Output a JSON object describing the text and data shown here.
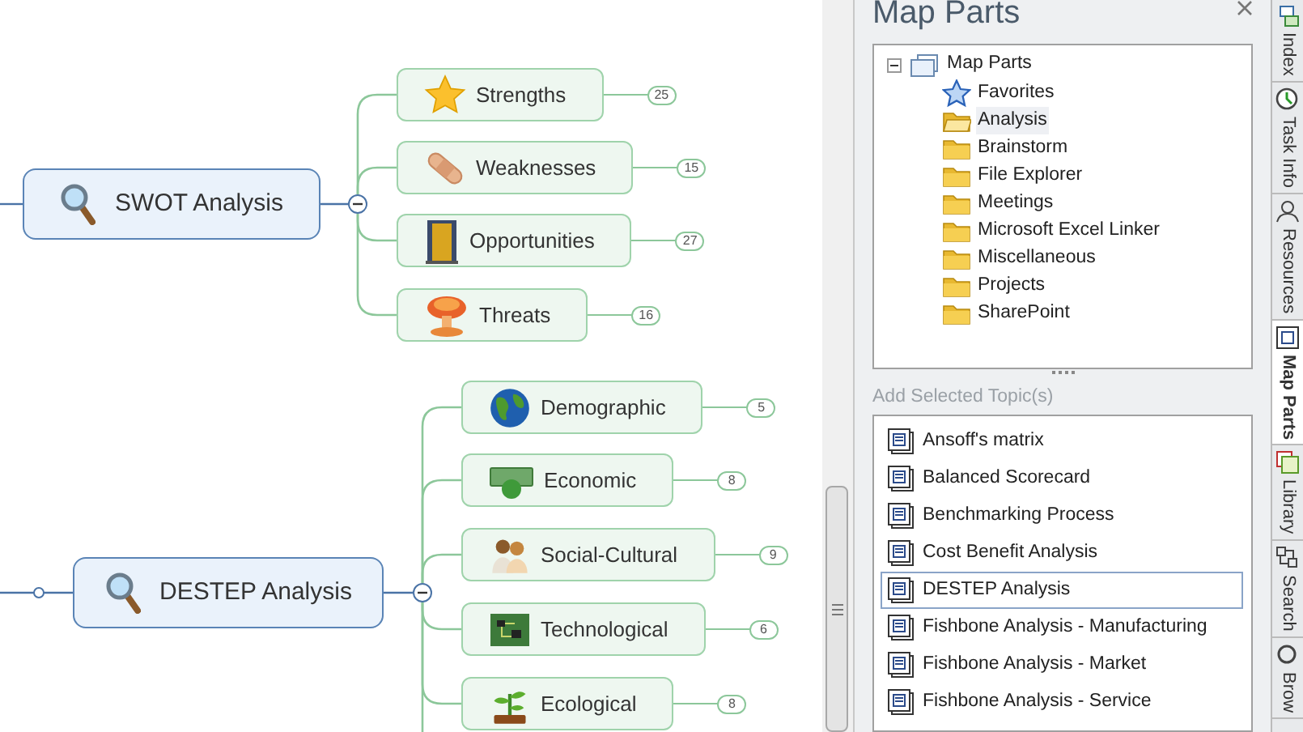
{
  "map": {
    "topics": [
      {
        "title": "SWOT Analysis",
        "expanded": true,
        "subtopics": [
          {
            "label": "Strengths",
            "count": "25"
          },
          {
            "label": "Weaknesses",
            "count": "15"
          },
          {
            "label": "Opportunities",
            "count": "27"
          },
          {
            "label": "Threats",
            "count": "16"
          }
        ]
      },
      {
        "title": "DESTEP Analysis",
        "expanded": true,
        "subtopics": [
          {
            "label": "Demographic",
            "count": "5"
          },
          {
            "label": "Economic",
            "count": "8"
          },
          {
            "label": "Social-Cultural",
            "count": "9"
          },
          {
            "label": "Technological",
            "count": "6"
          },
          {
            "label": "Ecological",
            "count": "8"
          }
        ]
      }
    ]
  },
  "panel": {
    "title": "Map Parts",
    "tree": {
      "label": "Map Parts",
      "expanded": true,
      "children": [
        {
          "label": "Favorites",
          "kind": "favorites",
          "selected": false
        },
        {
          "label": "Analysis",
          "kind": "folder",
          "selected": true
        },
        {
          "label": "Brainstorm",
          "kind": "folder",
          "selected": false
        },
        {
          "label": "File Explorer",
          "kind": "folder",
          "selected": false
        },
        {
          "label": "Meetings",
          "kind": "folder",
          "selected": false
        },
        {
          "label": "Microsoft Excel Linker",
          "kind": "folder",
          "selected": false
        },
        {
          "label": "Miscellaneous",
          "kind": "folder",
          "selected": false
        },
        {
          "label": "Projects",
          "kind": "folder",
          "selected": false
        },
        {
          "label": "SharePoint",
          "kind": "folder",
          "selected": false
        }
      ]
    },
    "add_label": "Add Selected Topic(s)",
    "templates": [
      {
        "label": "Ansoff's matrix",
        "selected": false
      },
      {
        "label": "Balanced Scorecard",
        "selected": false
      },
      {
        "label": "Benchmarking Process",
        "selected": false
      },
      {
        "label": "Cost Benefit Analysis",
        "selected": false
      },
      {
        "label": "DESTEP Analysis",
        "selected": true
      },
      {
        "label": "Fishbone Analysis - Manufacturing",
        "selected": false
      },
      {
        "label": "Fishbone Analysis - Market",
        "selected": false
      },
      {
        "label": "Fishbone Analysis - Service",
        "selected": false
      }
    ]
  },
  "side_tabs": [
    {
      "label": "Index",
      "selected": false
    },
    {
      "label": "Task Info",
      "selected": false
    },
    {
      "label": "Resources",
      "selected": false
    },
    {
      "label": "Map Parts",
      "selected": true
    },
    {
      "label": "Library",
      "selected": false
    },
    {
      "label": "Search",
      "selected": false
    },
    {
      "label": "Brow",
      "selected": false
    }
  ]
}
